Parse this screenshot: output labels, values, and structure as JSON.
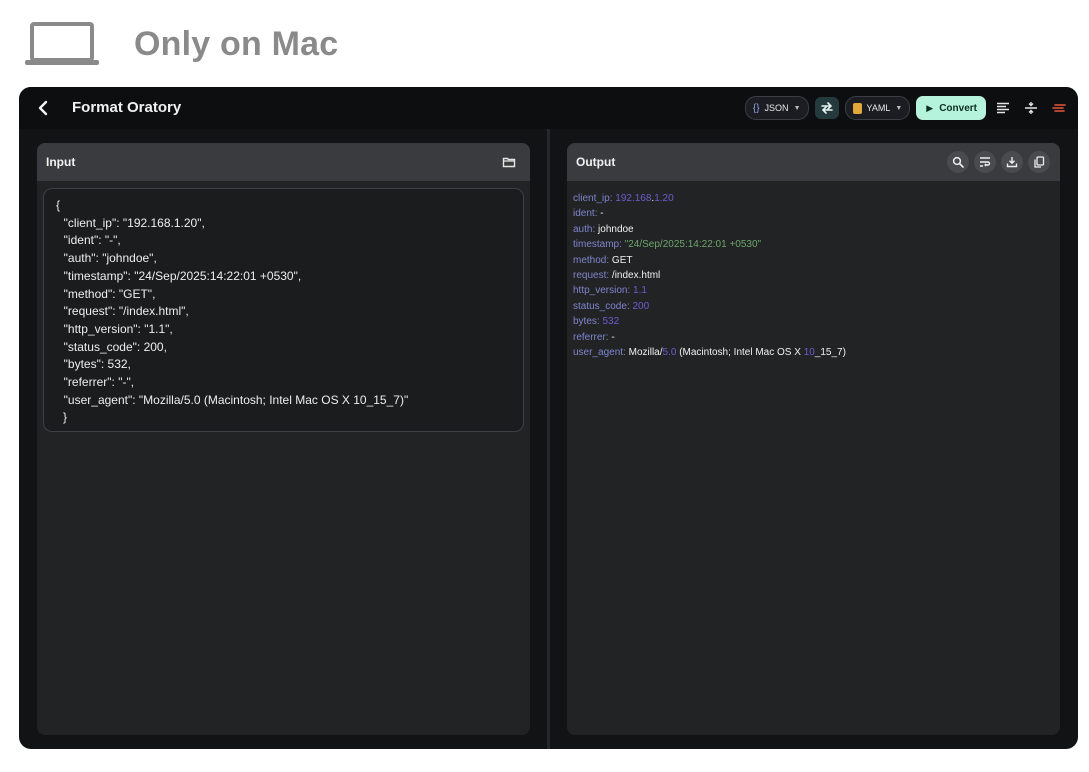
{
  "banner": {
    "text": "Only on Mac",
    "icon": "laptop-icon"
  },
  "app": {
    "title": "Format Oratory",
    "toolbar": {
      "source_format": "JSON",
      "target_format": "YAML",
      "convert_label": "Convert"
    }
  },
  "input": {
    "title": "Input",
    "lines": [
      "{",
      "  \"client_ip\": \"192.168.1.20\",",
      "  \"ident\": \"-\",",
      "  \"auth\": \"johndoe\",",
      "  \"timestamp\": \"24/Sep/2025:14:22:01 +0530\",",
      "  \"method\": \"GET\",",
      "  \"request\": \"/index.html\",",
      "  \"http_version\": \"1.1\",",
      "  \"status_code\": 200,",
      "  \"bytes\": 532,",
      "  \"referrer\": \"-\",",
      "  \"user_agent\": \"Mozilla/5.0 (Macintosh; Intel Mac OS X 10_15_7)\"",
      "}"
    ]
  },
  "output": {
    "title": "Output",
    "lines": [
      {
        "key": "client_ip",
        "segments": [
          {
            "t": "192.168",
            "c": "n"
          },
          {
            "t": ".",
            "c": "v"
          },
          {
            "t": "1.20",
            "c": "n"
          }
        ]
      },
      {
        "key": "ident",
        "segments": [
          {
            "t": "-",
            "c": "v"
          }
        ]
      },
      {
        "key": "auth",
        "segments": [
          {
            "t": "johndoe",
            "c": "v"
          }
        ]
      },
      {
        "key": "timestamp",
        "segments": [
          {
            "t": "\"24/Sep/2025:14:22:01 +0530\"",
            "c": "s"
          }
        ]
      },
      {
        "key": "method",
        "segments": [
          {
            "t": "GET",
            "c": "v"
          }
        ]
      },
      {
        "key": "request",
        "segments": [
          {
            "t": "/index.html",
            "c": "v"
          }
        ]
      },
      {
        "key": "http_version",
        "segments": [
          {
            "t": "1.1",
            "c": "n"
          }
        ]
      },
      {
        "key": "status_code",
        "segments": [
          {
            "t": "200",
            "c": "n"
          }
        ]
      },
      {
        "key": "bytes",
        "segments": [
          {
            "t": "532",
            "c": "n"
          }
        ]
      },
      {
        "key": "referrer",
        "segments": [
          {
            "t": "-",
            "c": "v"
          }
        ]
      },
      {
        "key": "user_agent",
        "segments": [
          {
            "t": "Mozilla/",
            "c": "v"
          },
          {
            "t": "5.0",
            "c": "n"
          },
          {
            "t": " (Macintosh; Intel Mac OS X ",
            "c": "v"
          },
          {
            "t": "10",
            "c": "n"
          },
          {
            "t": "_15_7)",
            "c": "v"
          }
        ]
      }
    ]
  },
  "colors": {
    "app_bg": "#121315",
    "panel_bg": "#222324",
    "panel_header": "#3a3b3e",
    "accent_convert": "#b6f3dc",
    "yaml_key": "#7f86cf",
    "yaml_number": "#6f5bd0",
    "yaml_string": "#6ea56d"
  }
}
